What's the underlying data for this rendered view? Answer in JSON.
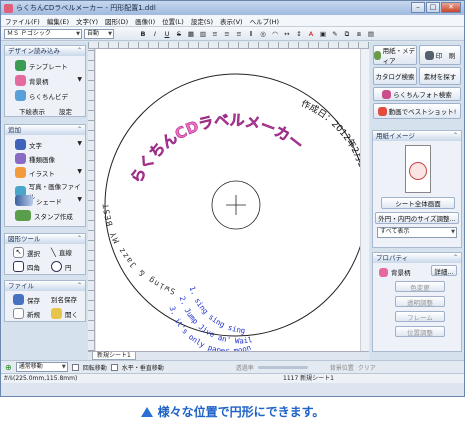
{
  "window": {
    "title": "らくちんCDラベルメーカー - 円形配置1.ddl"
  },
  "menu": [
    "ファイル(F)",
    "編集(E)",
    "文字(Y)",
    "図形(D)",
    "画像(I)",
    "位置(L)",
    "設定(S)",
    "表示(V)",
    "ヘルプ(H)"
  ],
  "toolbar": {
    "font": "ＭＳ Ｐゴシック",
    "size": "自動",
    "bold": "B",
    "italic": "I",
    "underline": "U",
    "strike": "S"
  },
  "left": {
    "design": {
      "title": "デザイン読み込み",
      "template": "テンプレート",
      "background": "背景柄",
      "rakuchin": "らくちんビデ",
      "below": "下絵表示",
      "settings": "設定"
    },
    "add": {
      "title": "追加",
      "text": "文字",
      "sample": "種類画像",
      "illust": "イラスト",
      "photo": "写真・画像ファイル",
      "shade": "シェード",
      "stamp": "スタンプ作成"
    },
    "shape": {
      "title": "図形ツール",
      "select": "選択",
      "line": "直線",
      "rect": "四角",
      "circle": "円"
    },
    "file": {
      "title": "ファイル",
      "save": "保存",
      "save_as": "別名保存",
      "new": "新規",
      "open": "開く"
    }
  },
  "canvas": {
    "arc_title": "らくちんCDラベルメーカー",
    "left_arc": "Swing & Jazz MY BEST",
    "right_arc": "作成日：2012年2月17日",
    "songs": [
      "1. sing sing sing",
      "2. Jump Jive an' Wail",
      "3. it's only paper moon"
    ],
    "sheet_tab": "新規シート1"
  },
  "right": {
    "media": "用紙・メディア",
    "print": "印　刷",
    "catalog": "カタログ検索",
    "material": "素材を探す",
    "photo_search": "らくちんフォト検索",
    "video": "動画でベストショット!",
    "paper_image": {
      "title": "用紙イメージ",
      "btn": "シート全体画面",
      "inner_outer": "外円・内円のサイズ調整...",
      "show_all": "すべて表示"
    },
    "property": {
      "title": "プロパティ",
      "bg": "背景柄",
      "detail": "詳細...",
      "items": [
        "色変更",
        "透明調整",
        "フレーム",
        "位置調整"
      ]
    }
  },
  "bottom": {
    "move_mode": "通常移動",
    "rotate_move": "回転移動",
    "hv_move": "水平・垂直移動",
    "transparency": "透過率",
    "bg_pos": "背景位置",
    "clear": "クリア"
  },
  "status": {
    "coords": "ｶｿﾙ(225.0mm,115.8mm)",
    "sheet": "1117 新規シート1"
  },
  "caption": "様々な位置で円形にできます。"
}
